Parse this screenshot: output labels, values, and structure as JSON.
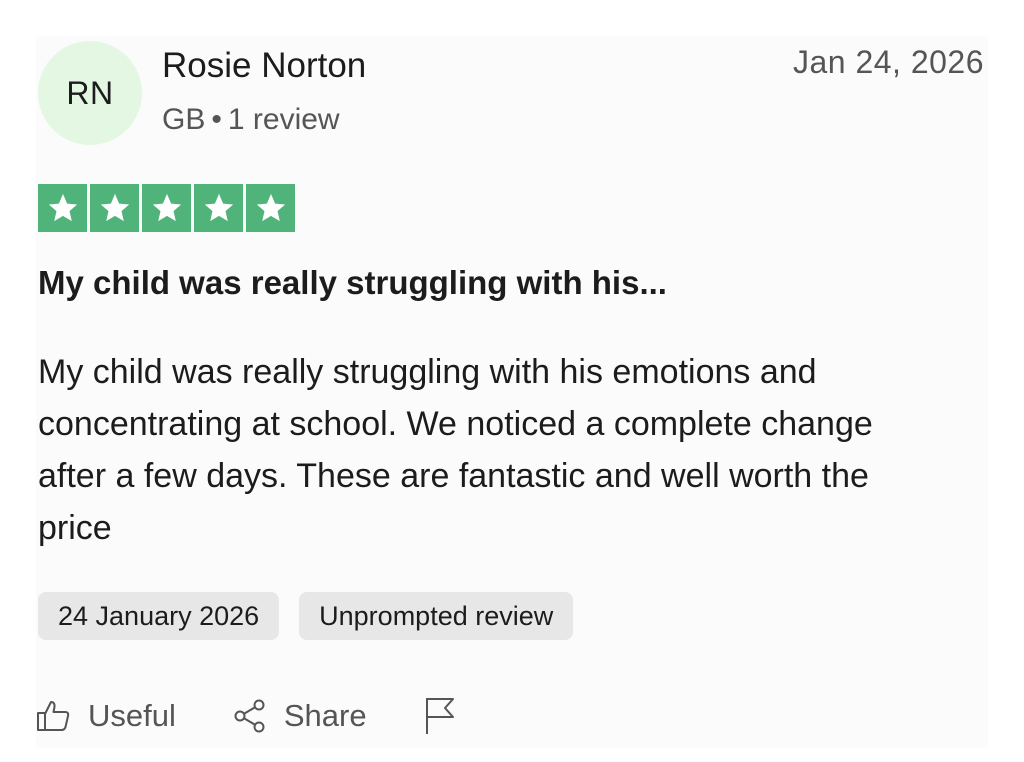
{
  "reviewer": {
    "initials": "RN",
    "name": "Rosie Norton",
    "country": "GB",
    "separator": "•",
    "review_count": "1 review",
    "avatar_color": "#e3f7e3"
  },
  "review": {
    "date": "Jan 24, 2026",
    "rating": 5,
    "rating_max": 5,
    "star_color": "#4fb37a",
    "title": "My child was really struggling with his...",
    "body": "My child was really struggling with his emotions and concentrating at school. We noticed a complete change after a few days. These are fantastic and well worth the price",
    "tags": [
      "24 January 2026",
      "Unprompted review"
    ]
  },
  "actions": {
    "useful_label": "Useful",
    "share_label": "Share",
    "useful_icon": "thumbs-up-icon",
    "share_icon": "share-icon",
    "report_icon": "flag-icon"
  }
}
